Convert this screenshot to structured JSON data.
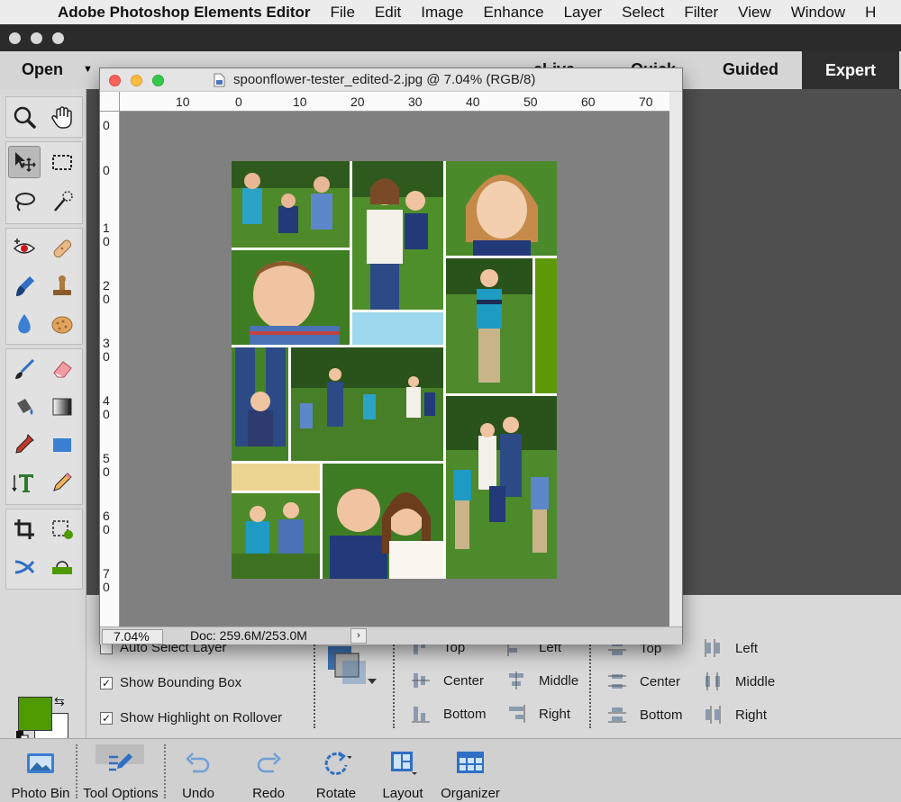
{
  "menubar": {
    "app_name": "Adobe Photoshop Elements Editor",
    "items": [
      "File",
      "Edit",
      "Image",
      "Enhance",
      "Layer",
      "Select",
      "Filter",
      "View",
      "Window",
      "H"
    ]
  },
  "modebar": {
    "open_label": "Open",
    "modes": [
      "eLive",
      "Quick",
      "Guided",
      "Expert"
    ],
    "active_mode": "Expert"
  },
  "document": {
    "title": "spoonflower-tester_edited-2.jpg @ 7.04% (RGB/8)",
    "zoom": "7.04%",
    "doc_size": "Doc: 259.6M/253.0M",
    "ruler_h": [
      "10",
      "0",
      "10",
      "20",
      "30",
      "40",
      "50",
      "60",
      "70"
    ],
    "ruler_v": [
      "0",
      "0",
      "1\n0",
      "2\n0",
      "3\n0",
      "4\n0",
      "5\n0",
      "6\n0",
      "7\n0"
    ]
  },
  "colors": {
    "foreground": "#4f9a01",
    "background": "#ffffff",
    "collage_blue": "#9dd8ee",
    "collage_green": "#5e9a08",
    "collage_sand": "#ecd491"
  },
  "tool_options": {
    "auto_select_layer": "Auto Select Layer",
    "show_bounding_box": "Show Bounding Box",
    "show_highlight": "Show Highlight on Rollover",
    "align_col1": [
      "Top",
      "Center",
      "Bottom"
    ],
    "align_col2": [
      "Left",
      "Middle",
      "Right"
    ],
    "distribute_col1": [
      "Top",
      "Center",
      "Bottom"
    ],
    "distribute_col2": [
      "Left",
      "Middle",
      "Right"
    ]
  },
  "taskbar": {
    "photo_bin": "Photo Bin",
    "tool_options": "Tool Options",
    "undo": "Undo",
    "redo": "Redo",
    "rotate": "Rotate",
    "layout": "Layout",
    "organizer": "Organizer"
  }
}
